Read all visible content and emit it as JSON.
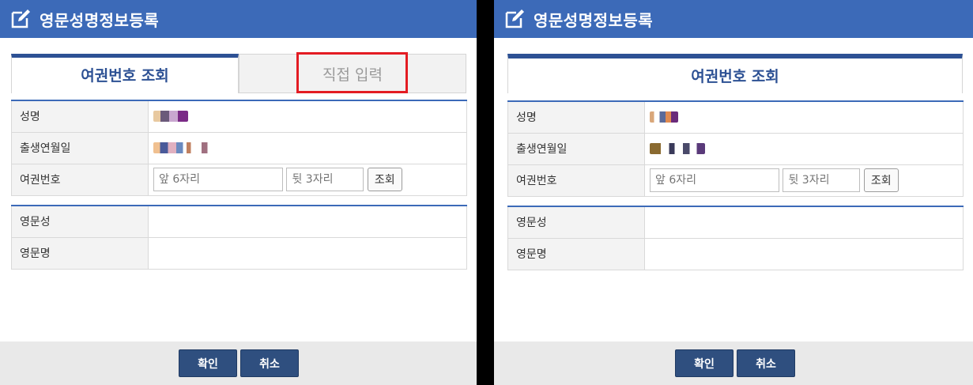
{
  "dialog_title": "영문성명정보등록",
  "tabs": {
    "passport_lookup": "여권번호 조회",
    "direct_input": "직접 입력"
  },
  "fields": {
    "name_label": "성명",
    "birth_label": "출생연월일",
    "passport_label": "여권번호",
    "front_placeholder": "앞 6자리",
    "back_placeholder": "뒷 3자리",
    "lookup_button": "조회",
    "english_surname_label": "영문성",
    "english_given_label": "영문명"
  },
  "buttons": {
    "confirm": "확인",
    "cancel": "취소"
  },
  "icons": {
    "title_icon": "edit-icon"
  },
  "colors": {
    "title_bar": "#3c6ab8",
    "tab_active": "#2d5194",
    "highlight_box": "#e31c23",
    "footer_button": "#2f4f7f"
  }
}
